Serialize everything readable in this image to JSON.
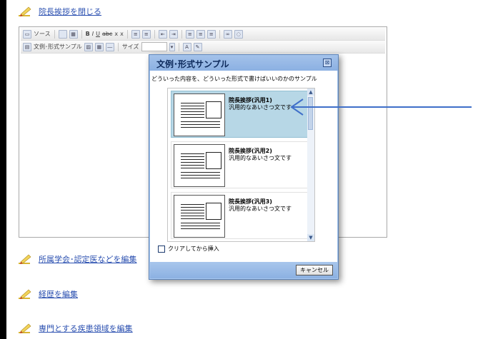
{
  "sections": {
    "close_greeting": "院長挨拶を閉じる",
    "edit_affiliation": "所属学会･認定医などを編集",
    "edit_career": "経歴を編集",
    "edit_specialty": "専門とする疾患領域を編集"
  },
  "toolbar": {
    "source_label": "ソース",
    "bold": "B",
    "italic": "I",
    "underline": "U",
    "strike": "abc",
    "subscript": "x",
    "superscript": "x",
    "template_label": "文例･形式サンプル",
    "size_label": "サイズ",
    "size_value": ""
  },
  "dialog": {
    "title": "文例･形式サンプル",
    "close_glyph": "⊠",
    "instruction": "どういった内容を、どういった形式で書けばいいのかのサンプル",
    "templates": [
      {
        "title": "院長挨拶(汎用1)",
        "description": "汎用的なあいさつ文です",
        "selected": true
      },
      {
        "title": "院長挨拶(汎用2)",
        "description": "汎用的なあいさつ文です",
        "selected": false
      },
      {
        "title": "院長挨拶(汎用3)",
        "description": "汎用的なあいさつ文です",
        "selected": false
      }
    ],
    "clear_insert_label": "クリアしてから挿入",
    "clear_insert_checked": false,
    "cancel_label": "キャンセル"
  },
  "colors": {
    "link": "#2a4fb0",
    "dialog_frame": "#a9c8ee",
    "selected_item": "#b7d7e6",
    "annotation_arrow": "#3f6fc9"
  }
}
